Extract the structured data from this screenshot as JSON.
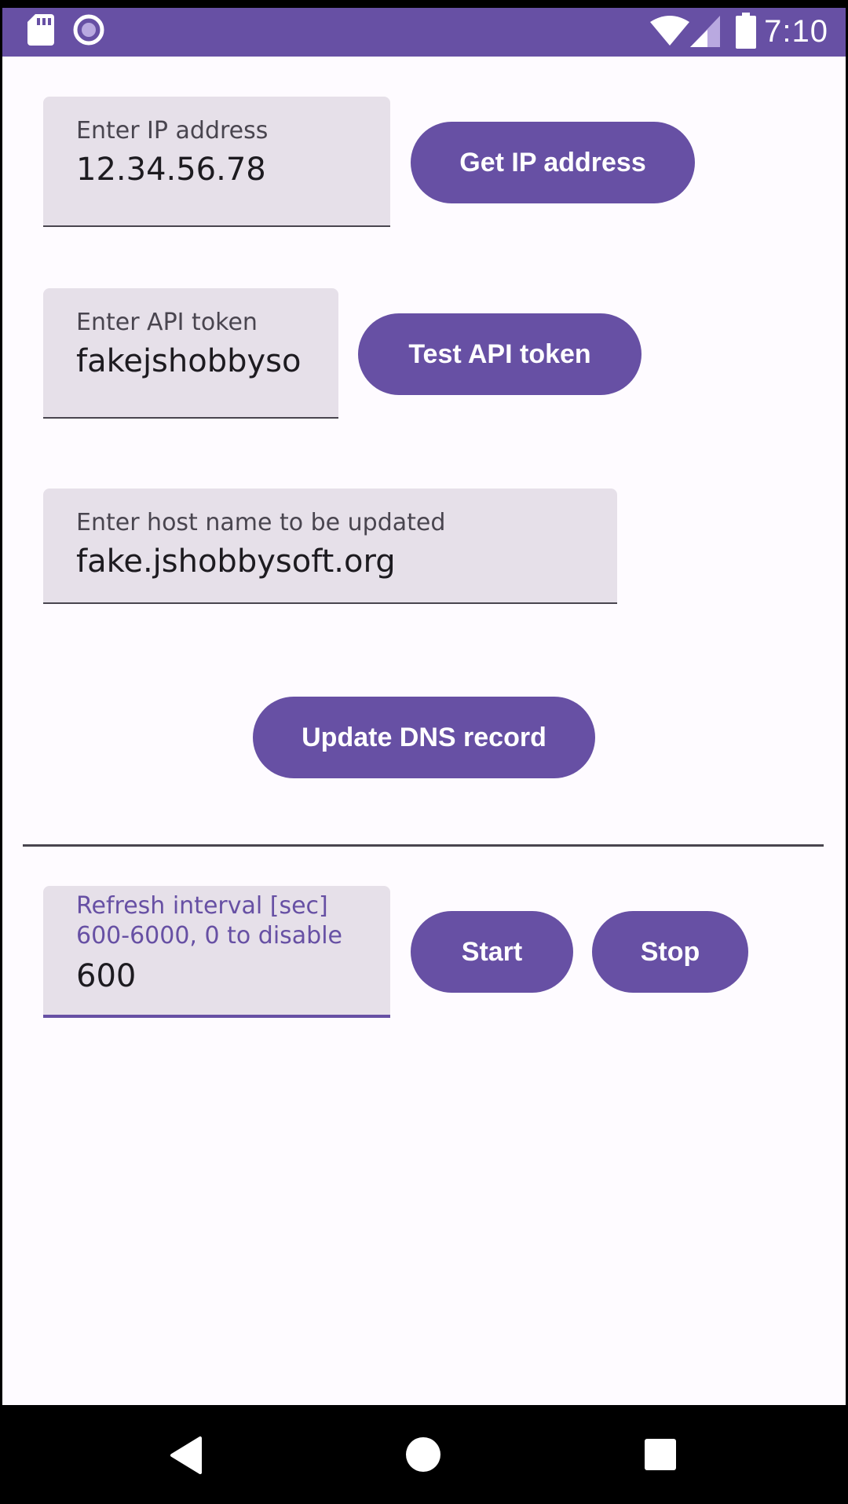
{
  "status_bar": {
    "time": "7:10",
    "icons": [
      "sd-card-icon",
      "record-icon",
      "wifi-icon",
      "cell-signal-icon",
      "battery-icon"
    ],
    "background": "#6750a4"
  },
  "ip_section": {
    "label": "Enter IP address",
    "value": "12.34.56.78",
    "button_label": "Get IP address"
  },
  "token_section": {
    "label": "Enter API token",
    "value": "fakejshobbyso",
    "button_label": "Test API token"
  },
  "host_section": {
    "label": "Enter host name to be updated",
    "value": "fake.jshobbysoft.org"
  },
  "update_button_label": "Update DNS record",
  "refresh_section": {
    "label_line1": "Refresh interval [sec]",
    "label_line2": "600-6000, 0 to disable",
    "value": "600",
    "start_label": "Start",
    "stop_label": "Stop"
  },
  "nav_bar": {
    "icons": [
      "back-icon",
      "home-icon",
      "recents-icon"
    ]
  },
  "colors": {
    "primary": "#6750a4",
    "field_bg": "#e6e0e9",
    "surface": "#fefbff"
  }
}
